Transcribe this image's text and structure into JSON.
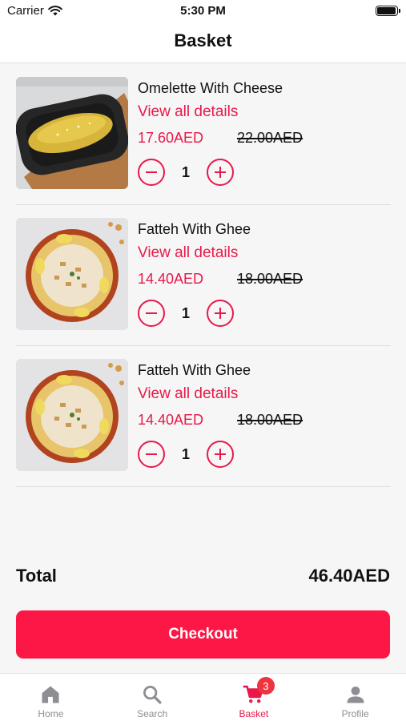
{
  "status_bar": {
    "carrier": "Carrier",
    "time": "5:30 PM"
  },
  "header": {
    "title": "Basket"
  },
  "basket": {
    "items": [
      {
        "name": "Omelette With Cheese",
        "details_link": "View all details",
        "price": "17.60AED",
        "old_price": "22.00AED",
        "quantity": "1",
        "image_icon": "omelette-photo"
      },
      {
        "name": "Fatteh With Ghee",
        "details_link": "View all details",
        "price": "14.40AED",
        "old_price": "18.00AED",
        "quantity": "1",
        "image_icon": "fatteh-photo"
      },
      {
        "name": "Fatteh With Ghee",
        "details_link": "View all details",
        "price": "14.40AED",
        "old_price": "18.00AED",
        "quantity": "1",
        "image_icon": "fatteh-photo"
      }
    ]
  },
  "summary": {
    "total_label": "Total",
    "total_value": "46.40AED"
  },
  "checkout": {
    "label": "Checkout"
  },
  "tabs": [
    {
      "label": "Home",
      "icon": "home-icon"
    },
    {
      "label": "Search",
      "icon": "search-icon"
    },
    {
      "label": "Basket",
      "icon": "cart-icon",
      "badge": "3",
      "active": true
    },
    {
      "label": "Profile",
      "icon": "person-icon"
    }
  ],
  "colors": {
    "accent": "#e8194a",
    "checkout_button": "#fd1746",
    "badge": "#ef3340",
    "tab_inactive": "#8e8e93"
  }
}
